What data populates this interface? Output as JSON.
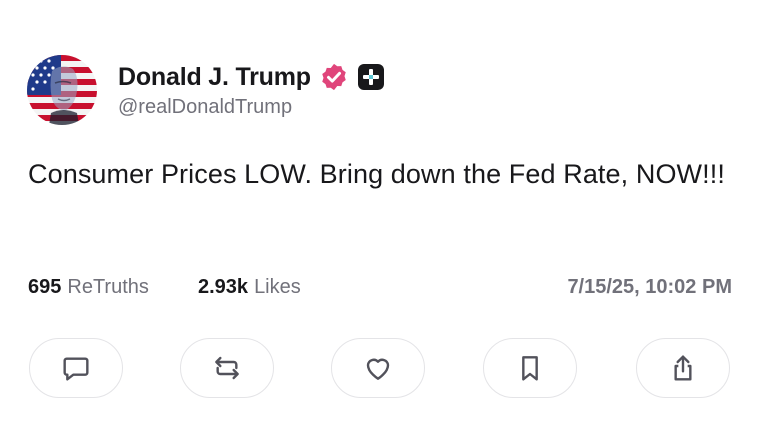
{
  "author": {
    "display_name": "Donald J. Trump",
    "handle": "@realDonaldTrump",
    "verified_badge_color": "#e0457b",
    "avatar_icon": "flag-portrait-avatar"
  },
  "post": {
    "text": "Consumer Prices LOW. Bring down the Fed Rate, NOW!!!"
  },
  "stats": {
    "retruths_count": "695",
    "retruths_label": "ReTruths",
    "likes_count": "2.93k",
    "likes_label": "Likes",
    "timestamp": "7/15/25, 10:02 PM"
  },
  "actions": [
    {
      "name": "reply",
      "icon": "reply-icon"
    },
    {
      "name": "retruth",
      "icon": "retruth-icon"
    },
    {
      "name": "like",
      "icon": "heart-icon"
    },
    {
      "name": "bookmark",
      "icon": "bookmark-icon"
    },
    {
      "name": "share",
      "icon": "share-icon"
    }
  ],
  "colors": {
    "text_primary": "#18181b",
    "text_secondary": "#71717a",
    "border": "#e4e4e7",
    "icon": "#52525b"
  }
}
